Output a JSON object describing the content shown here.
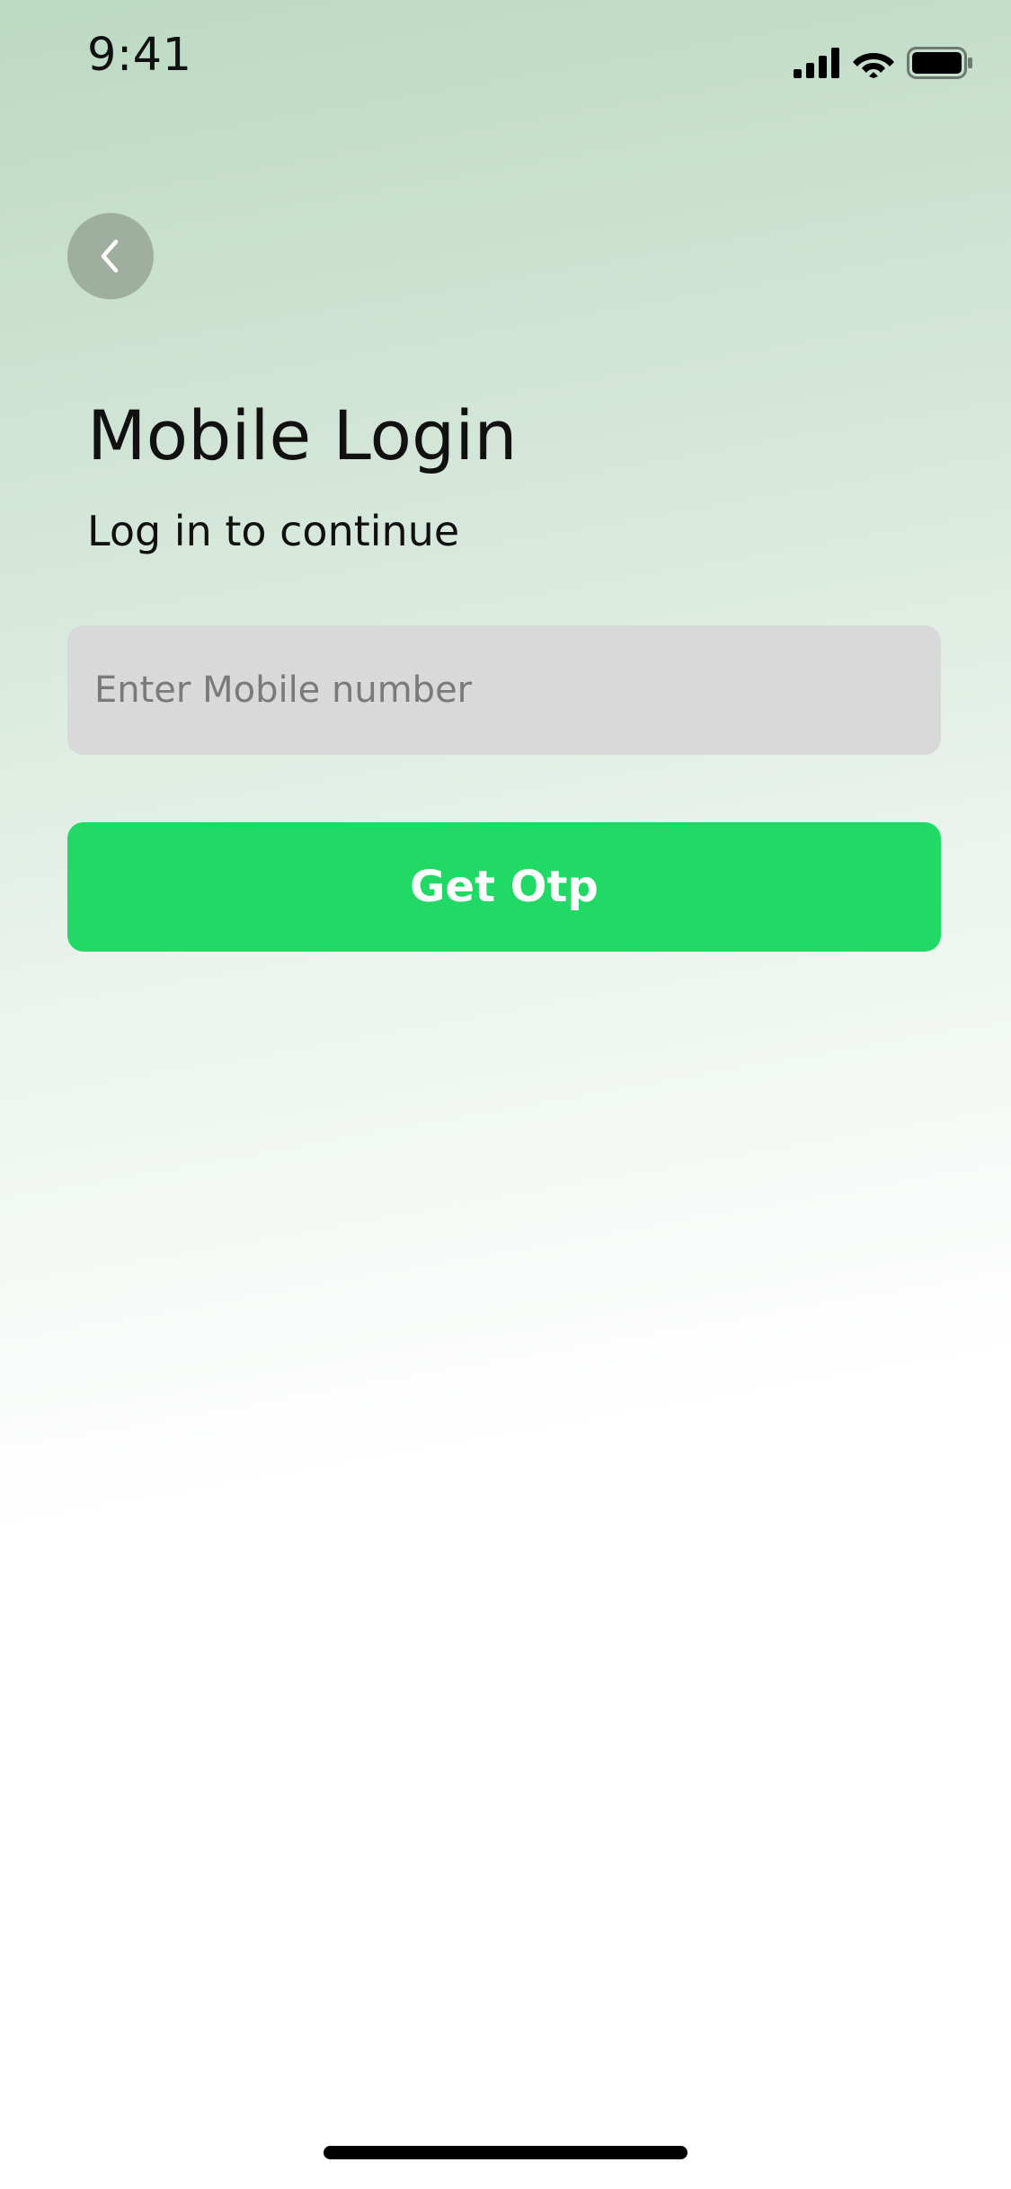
{
  "status_bar": {
    "time": "9:41",
    "icons": [
      "cellular-signal-icon",
      "wifi-icon",
      "battery-icon"
    ]
  },
  "header": {
    "back_icon": "chevron-left-icon",
    "title": "Mobile Login",
    "subtitle": "Log in to continue"
  },
  "form": {
    "mobile_input": {
      "value": "",
      "placeholder": "Enter Mobile number"
    },
    "submit_label": "Get Otp"
  },
  "colors": {
    "accent": "#21d965",
    "input_background": "#d9d9d9",
    "back_button": "#9faf9f",
    "gradient_top": "#bcd9c2"
  }
}
